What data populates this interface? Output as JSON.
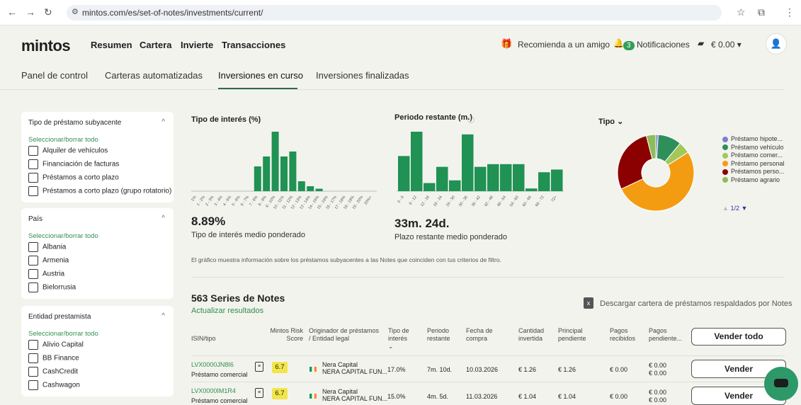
{
  "browser": {
    "url": "mintos.com/es/set-of-notes/investments/current/"
  },
  "header": {
    "logo": "mintos",
    "nav": [
      "Resumen",
      "Cartera",
      "Invierte",
      "Transacciones"
    ],
    "recommend": "Recomienda a un amigo",
    "notif_count": "3",
    "notifications": "Notificaciones",
    "balance": "€ 0.00"
  },
  "tabs": [
    "Panel de control",
    "Carteras automatizadas",
    "Inversiones en curso",
    "Inversiones finalizadas"
  ],
  "filters": {
    "loan_type": {
      "title": "Tipo de préstamo subyacente",
      "select_all": "Seleccionar/borrar todo",
      "items": [
        "Alquiler de vehículos",
        "Financiación de facturas",
        "Préstamos a corto plazo",
        "Préstamos a corto plazo (grupo rotatorio)"
      ]
    },
    "country": {
      "title": "País",
      "select_all": "Seleccionar/borrar todo",
      "items": [
        "Albania",
        "Armenia",
        "Austria",
        "Bielorrusia"
      ]
    },
    "lender": {
      "title": "Entidad prestamista",
      "select_all": "Seleccionar/borrar todo",
      "items": [
        "Alivio Capital",
        "BB Finance",
        "CashCredit",
        "Cashwagon"
      ]
    }
  },
  "charts": {
    "rate_title": "Tipo de interés (%)",
    "rate_value": "8.89%",
    "rate_sub": "Tipo de interés medio ponderado",
    "period_title": "Periodo restante (m.)",
    "period_value": "33m. 24d.",
    "period_sub": "Plazo restante medio ponderado",
    "type_title": "Tipo",
    "legend_page": "1/2",
    "note": "El gráfico muestra información sobre los préstamos subyacentes a las Notes que coinciden con tus criterios de filtro."
  },
  "chart_data": [
    {
      "type": "bar",
      "title": "Tipo de interés (%)",
      "categories": [
        "0 - 1%",
        "1 - 2%",
        "2 - 3%",
        "3 - 4%",
        "4 - 5%",
        "5 - 6%",
        "6 - 7%",
        "7 - 8%",
        "8 - 9%",
        "9 - 10%",
        "10 - 11%",
        "11 - 12%",
        "12 - 13%",
        "13 - 14%",
        "14 - 15%",
        "15 - 16%",
        "16 - 17%",
        "17 - 18%",
        "18 - 19%",
        "19 - 20%",
        "20%+"
      ],
      "values": [
        0,
        0,
        0,
        0,
        0,
        0,
        0,
        10,
        14,
        24,
        14,
        16,
        4,
        2,
        1,
        0,
        0,
        0,
        0,
        0,
        0
      ]
    },
    {
      "type": "bar",
      "title": "Periodo restante (m.)",
      "categories": [
        "0 - 6",
        "6 - 12",
        "12 - 18",
        "18 - 24",
        "24 - 30",
        "30 - 36",
        "36 - 42",
        "42 - 48",
        "48 - 54",
        "54 - 60",
        "60 - 66",
        "66 - 72",
        "72+"
      ],
      "values": [
        13,
        22,
        3,
        9,
        4,
        21,
        9,
        10,
        10,
        10,
        1,
        7,
        8
      ]
    },
    {
      "type": "pie",
      "title": "Tipo",
      "labels": [
        "Préstamo hipote...",
        "Préstamo vehículo",
        "Préstamo comer...",
        "Préstamo personal",
        "Préstamos perso...",
        "Préstamo agrario"
      ],
      "values": [
        1,
        10,
        5,
        52,
        28,
        4
      ],
      "colors": [
        "#7b7fd4",
        "#2f8f5b",
        "#a3c85a",
        "#f39c12",
        "#8b0000",
        "#8fbc5a"
      ]
    }
  ],
  "notes": {
    "count_title": "563 Series de Notes",
    "refresh": "Actualizar resultados",
    "download": "Descargar cartera de préstamos respaldados por Notes",
    "columns": [
      "ISIN/tipo",
      "Mintos Risk Score",
      "Originador de préstamos / Entidad legal",
      "Tipo de interés",
      "Periodo restante",
      "Fecha de compra",
      "Cantidad invertida",
      "Principal pendiente",
      "Pagos recibidos",
      "Pagos pendiente..."
    ],
    "sell_all": "Vender todo",
    "rows": [
      {
        "isin": "LVX0000JN8I6",
        "type": "Préstamo comercial",
        "score": "6.7",
        "originator": "Nera Capital",
        "entity": "NERA CAPITAL FUN...",
        "rate": "17.0%",
        "period": "7m. 10d.",
        "date": "10.03.2026",
        "invested": "€ 1.26",
        "principal": "€ 1.26",
        "received": "€ 0.00",
        "pending1": "€ 0.00",
        "pending2": "€ 0.00",
        "sell": "Vender"
      },
      {
        "isin": "LVX0000IM1R4",
        "type": "Préstamo comercial",
        "score": "6.7",
        "originator": "Nera Capital",
        "entity": "NERA CAPITAL FUN...",
        "rate": "15.0%",
        "period": "4m. 5d.",
        "date": "11.03.2026",
        "invested": "€ 1.04",
        "principal": "€ 1.04",
        "received": "€ 0.00",
        "pending1": "€ 0.00",
        "pending2": "€ 0.00",
        "sell": "Vender"
      }
    ]
  }
}
